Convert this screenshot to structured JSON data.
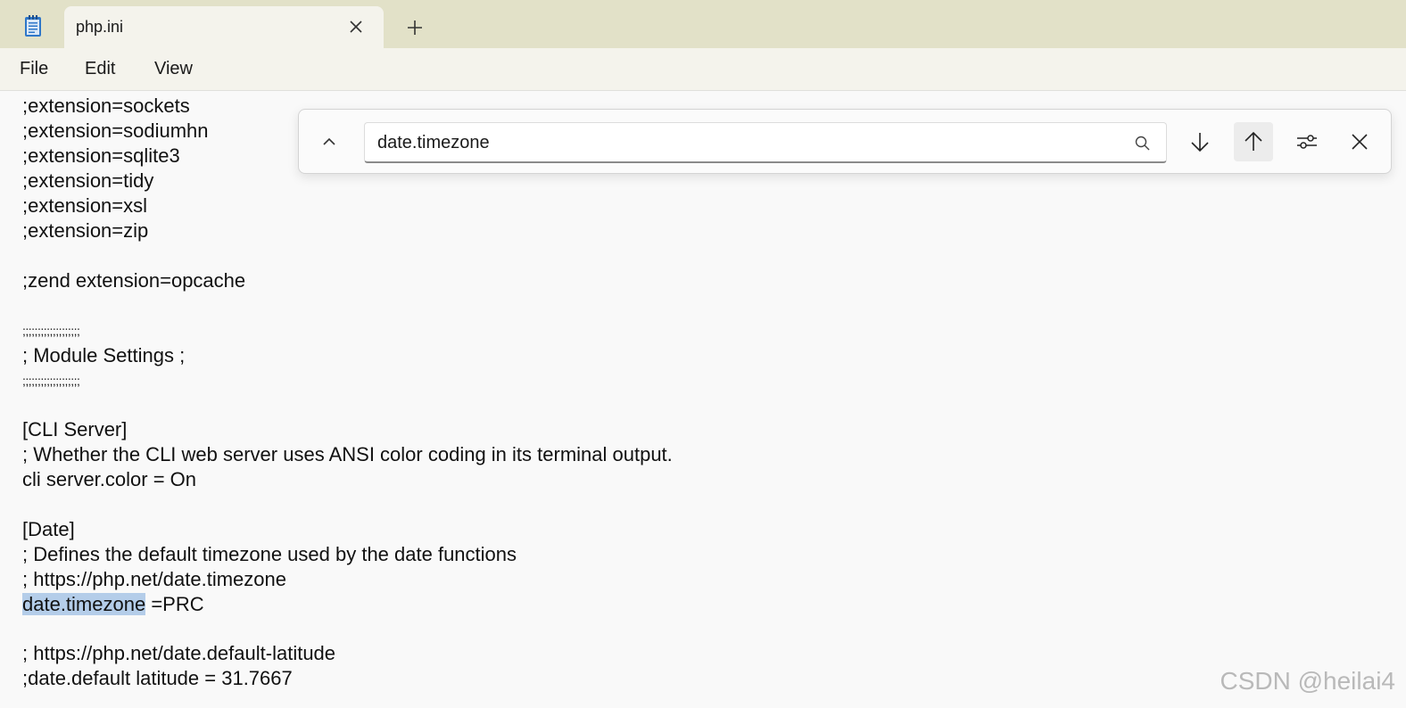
{
  "app": {
    "icon": "notepad-icon"
  },
  "tab": {
    "title": "php.ini",
    "close_icon": "close-icon",
    "new_tab_icon": "plus-icon"
  },
  "menu": {
    "file": "File",
    "edit": "Edit",
    "view": "View"
  },
  "find": {
    "value": "date.timezone",
    "toggle_icon": "chevron-up-icon",
    "search_icon": "search-icon",
    "next_icon": "arrow-down-icon",
    "prev_icon": "arrow-up-icon",
    "options_icon": "sliders-icon",
    "close_icon": "close-icon"
  },
  "editor": {
    "lines": [
      ";extension=sockets",
      ";extension=sodiumhn",
      ";extension=sqlite3",
      ";extension=tidy",
      ";extension=xsl",
      ";extension=zip",
      "",
      ";zend extension=opcache",
      "",
      ";;;;;;;;;;;;;;;;;;;",
      "; Module Settings ;",
      ";;;;;;;;;;;;;;;;;;;",
      "",
      "[CLI Server]",
      "; Whether the CLI web server uses ANSI color coding in its terminal output.",
      "cli server.color = On",
      "",
      "[Date]",
      "; Defines the default timezone used by the date functions",
      "; https://php.net/date.timezone",
      "",
      "",
      "; https://php.net/date.default-latitude",
      ";date.default latitude = 31.7667"
    ],
    "highlight_line": {
      "match": "date.timezone",
      "rest": " =PRC"
    }
  },
  "watermark": "CSDN @heilai4",
  "colors": {
    "titlebar": "#e2e1c8",
    "tab": "#f4f3ec",
    "editor_bg": "#f9f9f9",
    "selection": "#b4cde9"
  }
}
